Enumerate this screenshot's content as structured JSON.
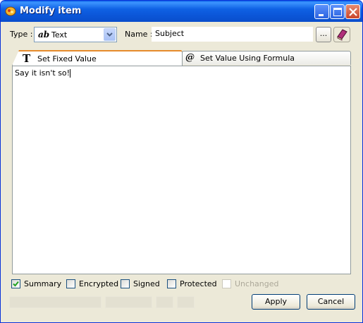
{
  "window": {
    "title": "Modify item"
  },
  "type_field": {
    "label": "Type :",
    "icon_text": "ab",
    "value": "Text"
  },
  "name_field": {
    "label": "Name :",
    "value": "Subject",
    "browse_label": "..."
  },
  "tabs": [
    {
      "label": "Set Fixed Value",
      "icon_text": "T",
      "active": true
    },
    {
      "label": "Set Value Using Formula",
      "icon_text": "@",
      "active": false
    }
  ],
  "editor": {
    "value": "Say it isn't so!"
  },
  "checkboxes": [
    {
      "label": "Summary",
      "checked": true,
      "enabled": true
    },
    {
      "label": "Encrypted",
      "checked": false,
      "enabled": true
    },
    {
      "label": "Signed",
      "checked": false,
      "enabled": true
    },
    {
      "label": "Protected",
      "checked": false,
      "enabled": true
    },
    {
      "label": "Unchanged",
      "checked": false,
      "enabled": false
    }
  ],
  "buttons": {
    "apply": "Apply",
    "cancel": "Cancel"
  },
  "colors": {
    "title_bar": "#0a5fe6",
    "dialog_bg": "#ece9d8",
    "active_tab_accent": "#e68b2c",
    "close_button": "#c9452b"
  }
}
